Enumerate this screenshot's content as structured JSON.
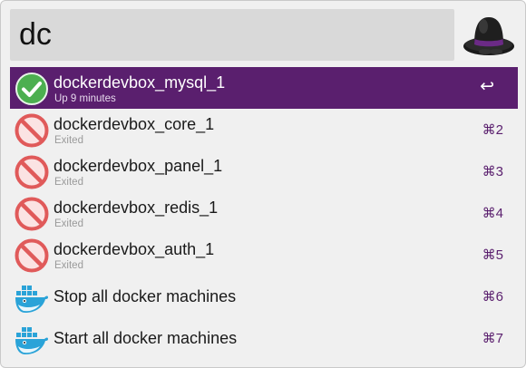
{
  "search": {
    "value": "dc"
  },
  "results": [
    {
      "title": "dockerdevbox_mysql_1",
      "subtitle": "Up 9 minutes",
      "shortcut": "↩",
      "icon": "check-icon",
      "selected": true
    },
    {
      "title": "dockerdevbox_core_1",
      "subtitle": "Exited",
      "shortcut": "⌘2",
      "icon": "prohibited-icon"
    },
    {
      "title": "dockerdevbox_panel_1",
      "subtitle": "Exited",
      "shortcut": "⌘3",
      "icon": "prohibited-icon"
    },
    {
      "title": "dockerdevbox_redis_1",
      "subtitle": "Exited",
      "shortcut": "⌘4",
      "icon": "prohibited-icon"
    },
    {
      "title": "dockerdevbox_auth_1",
      "subtitle": "Exited",
      "shortcut": "⌘5",
      "icon": "prohibited-icon"
    },
    {
      "title": "Stop all docker machines",
      "subtitle": "",
      "shortcut": "⌘6",
      "icon": "docker-whale-icon"
    },
    {
      "title": "Start all docker machines",
      "subtitle": "",
      "shortcut": "⌘7",
      "icon": "docker-whale-icon"
    }
  ],
  "colors": {
    "accent": "#5a1f6e",
    "success": "#4caf50",
    "stopped": "#e05a5a",
    "docker": "#2aa3d8"
  },
  "icons": {
    "app_logo": "alfred-hat-icon"
  }
}
